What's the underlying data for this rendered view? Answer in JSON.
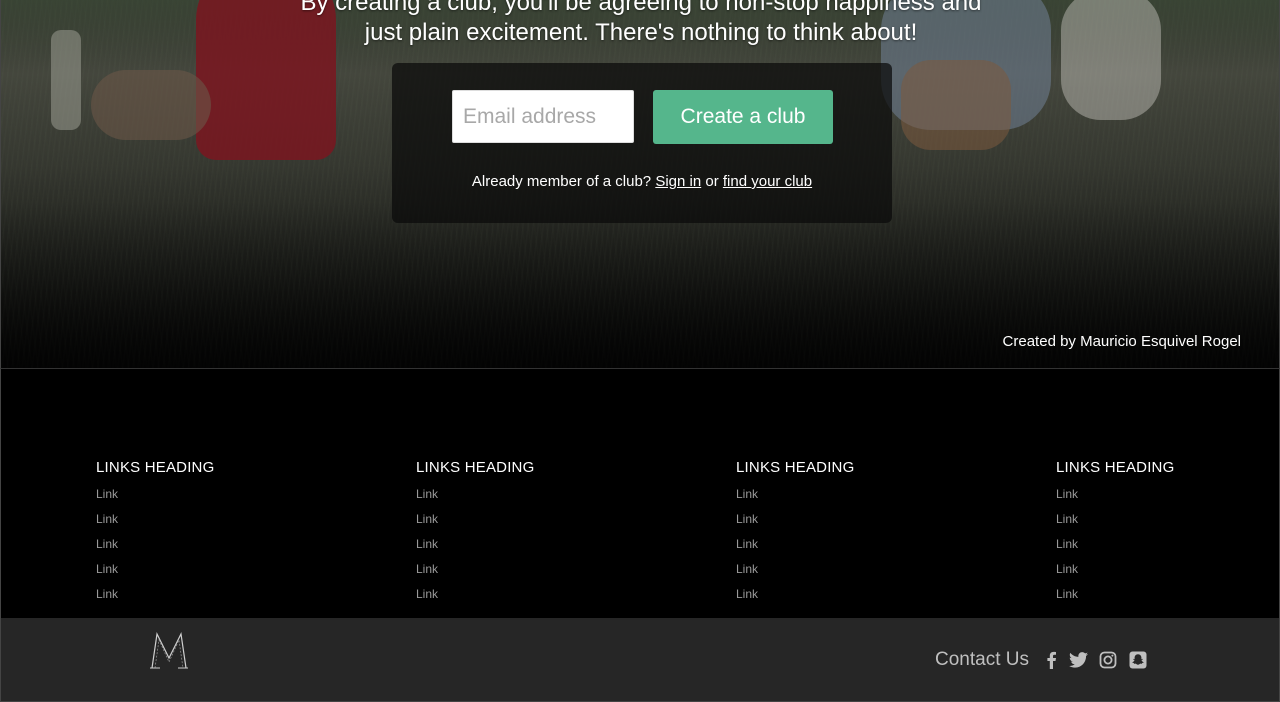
{
  "hero": {
    "lead_line1": "By creating a club, you'll be agreeing to non-stop happiness and",
    "lead_line2": "just plain excitement. There's nothing to think about!",
    "email_placeholder": "Email address",
    "create_label": "Create a club",
    "member_prefix": "Already member of a club?",
    "sign_in_label": "Sign in",
    "or_text": "or",
    "find_club_label": "find your club",
    "credit": "Created by Mauricio Esquivel Rogel"
  },
  "footer": {
    "columns": [
      {
        "heading": "LINKS HEADING",
        "links": [
          "Link",
          "Link",
          "Link",
          "Link",
          "Link"
        ]
      },
      {
        "heading": "LINKS HEADING",
        "links": [
          "Link",
          "Link",
          "Link",
          "Link",
          "Link"
        ]
      },
      {
        "heading": "LINKS HEADING",
        "links": [
          "Link",
          "Link",
          "Link",
          "Link",
          "Link"
        ]
      },
      {
        "heading": "LINKS HEADING",
        "links": [
          "Link",
          "Link",
          "Link",
          "Link",
          "Link"
        ]
      }
    ],
    "contact_label": "Contact Us",
    "social_icons": [
      "facebook-icon",
      "twitter-icon",
      "instagram-icon",
      "snapchat-icon"
    ]
  },
  "colors": {
    "accent_green": "#55b68c",
    "bottom_bar": "#262626",
    "link_gray": "#9a9a9a"
  }
}
